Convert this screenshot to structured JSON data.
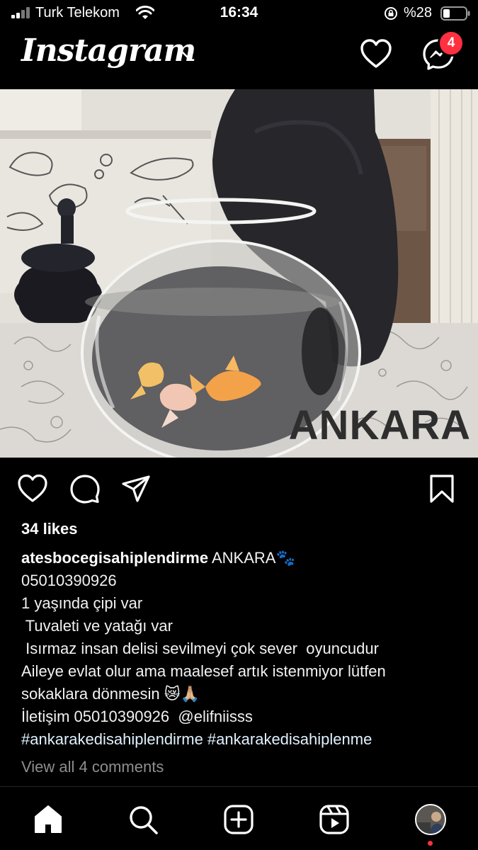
{
  "status_bar": {
    "carrier": "Turk Telekom",
    "time": "16:34",
    "battery": "%28",
    "battery_level": 0.28
  },
  "header": {
    "logo": "Instagram",
    "messages_badge": "4"
  },
  "post": {
    "image_text": "ANKARA",
    "likes": "34 likes",
    "username": "atesbocegisahiplendirme",
    "caption_lines": [
      " ANKARA🐾",
      "05010390926",
      "1 yaşında çipi var",
      " Tuvaleti ve yatağı var",
      " Isırmaz insan delisi sevilmeyi çok sever  oyuncudur",
      "Aileye evlat olur ama maalesef artık istenmiyor lütfen",
      "sokaklara dönmesin 😿🙏🏼",
      "İletişim 05010390926  @elifniisss",
      "#ankarakedisahiplendirme #ankarakedisahiplenme"
    ],
    "view_comments": "View all 4 comments"
  },
  "colors": {
    "background": "#000000",
    "badge": "#ff3040",
    "muted_text": "#8e8e8e"
  },
  "icons": {
    "header": [
      "chevron-down-icon",
      "heart-icon",
      "messenger-icon"
    ],
    "actions": [
      "heart-icon",
      "comment-icon",
      "share-icon",
      "bookmark-icon"
    ],
    "nav": [
      "home-icon",
      "search-icon",
      "create-icon",
      "reels-icon",
      "profile-avatar"
    ]
  }
}
